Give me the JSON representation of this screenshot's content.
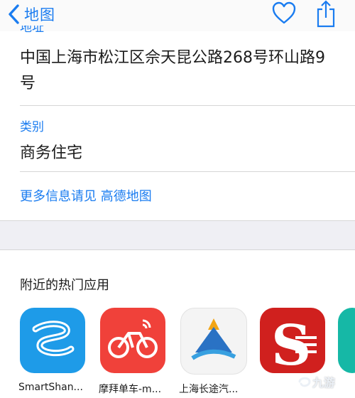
{
  "nav": {
    "back_label": "地图",
    "icons": {
      "back": "chevron-left-icon",
      "favorite": "heart-icon",
      "share": "share-icon"
    }
  },
  "details": {
    "address_label": "地址",
    "address_value": "中国上海市松江区佘天昆公路268号环山路9号",
    "category_label": "类别",
    "category_value": "商务住宅",
    "more_info_link": "更多信息请见 高德地图"
  },
  "nearby": {
    "title": "附近的热门应用",
    "apps": [
      {
        "name": "SmartShan...",
        "icon": "smartshan-app-icon"
      },
      {
        "name": "摩拜单车-m...",
        "icon": "bicycle-app-icon"
      },
      {
        "name": "上海长途汽...",
        "icon": "mountain-app-icon"
      },
      {
        "name": "",
        "icon": "s-logo-app-icon"
      },
      {
        "name": "",
        "icon": "teal-app-icon"
      }
    ]
  },
  "watermark": {
    "text": "九游"
  },
  "colors": {
    "accent": "#1a7cf0",
    "separator": "#d6d6d6",
    "band": "#efeff4"
  }
}
